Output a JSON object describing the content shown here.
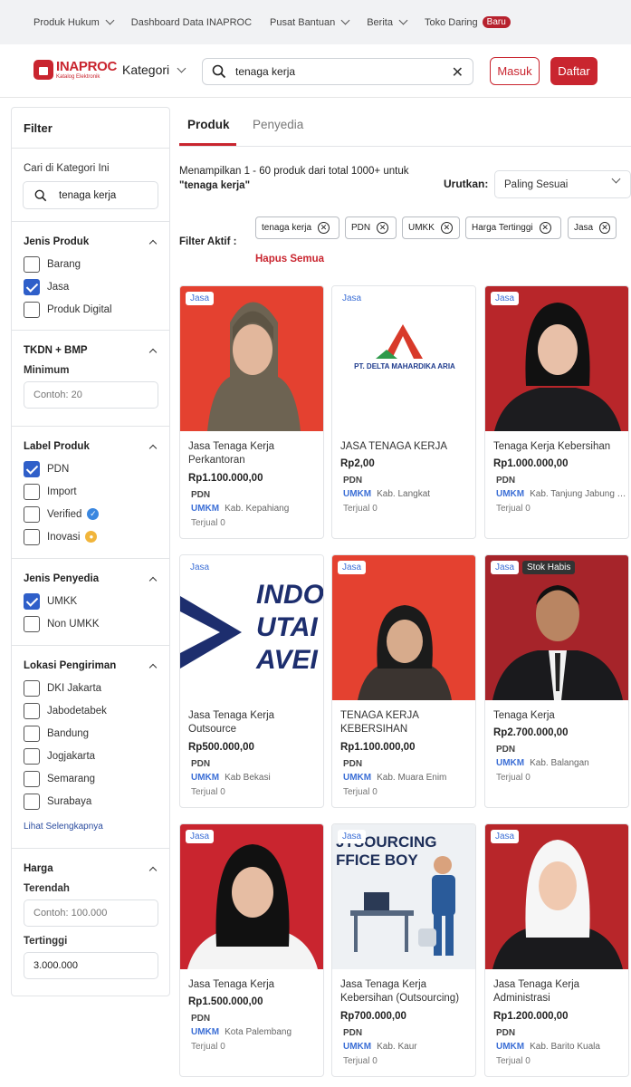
{
  "topbar": {
    "items": [
      {
        "label": "Produk Hukum",
        "chevron": true
      },
      {
        "label": "Dashboard Data INAPROC",
        "chevron": false
      },
      {
        "label": "Pusat Bantuan",
        "chevron": true
      },
      {
        "label": "Berita",
        "chevron": true
      },
      {
        "label": "Toko Daring",
        "chevron": false
      }
    ],
    "badge": "Baru"
  },
  "header": {
    "logo_main": "INAPROC",
    "logo_sub": "Katalog Elektronik",
    "kategori": "Kategori",
    "search_value": "tenaga kerja",
    "masuk": "Masuk",
    "daftar": "Daftar"
  },
  "sidebar": {
    "title": "Filter",
    "search_label": "Cari di Kategori Ini",
    "search_value": "tenaga kerja",
    "jenis_produk": {
      "title": "Jenis Produk",
      "options": [
        {
          "label": "Barang",
          "checked": false
        },
        {
          "label": "Jasa",
          "checked": true
        },
        {
          "label": "Produk Digital",
          "checked": false
        }
      ]
    },
    "tkdn": {
      "title": "TKDN + BMP",
      "min_label": "Minimum",
      "placeholder": "Contoh: 20"
    },
    "label_produk": {
      "title": "Label Produk",
      "options": [
        {
          "label": "PDN",
          "checked": true
        },
        {
          "label": "Import",
          "checked": false
        },
        {
          "label": "Verified",
          "checked": false,
          "icon": "verified-icon"
        },
        {
          "label": "Inovasi",
          "checked": false,
          "icon": "lightbulb-icon"
        }
      ]
    },
    "jenis_penyedia": {
      "title": "Jenis Penyedia",
      "options": [
        {
          "label": "UMKK",
          "checked": true
        },
        {
          "label": "Non UMKK",
          "checked": false
        }
      ]
    },
    "lokasi": {
      "title": "Lokasi Pengiriman",
      "options": [
        {
          "label": "DKI Jakarta",
          "checked": false
        },
        {
          "label": "Jabodetabek",
          "checked": false
        },
        {
          "label": "Bandung",
          "checked": false
        },
        {
          "label": "Jogjakarta",
          "checked": false
        },
        {
          "label": "Semarang",
          "checked": false
        },
        {
          "label": "Surabaya",
          "checked": false
        }
      ],
      "more": "Lihat Selengkapnya"
    },
    "harga": {
      "title": "Harga",
      "low_label": "Terendah",
      "low_placeholder": "Contoh: 100.000",
      "high_label": "Tertinggi",
      "high_value": "3.000.000"
    }
  },
  "tabs": [
    "Produk",
    "Penyedia"
  ],
  "results": {
    "line1": "Menampilkan 1 - 60 produk dari total 1000+ untuk",
    "query": "\"tenaga kerja\""
  },
  "sort": {
    "label": "Urutkan:",
    "value": "Paling Sesuai"
  },
  "filters": {
    "label": "Filter Aktif :",
    "chips": [
      "tenaga kerja",
      "PDN",
      "UMKK",
      "Harga Tertinggi",
      "Jasa"
    ],
    "clear": "Hapus Semua"
  },
  "products": [
    {
      "tag": "Jasa",
      "name": "Jasa Tenaga Kerja Perkantoran",
      "price": "Rp1.100.000,00",
      "pdn": "PDN",
      "umkm": "UMKM",
      "loc": "Kab. Kepahiang",
      "sold": "Terjual 0"
    },
    {
      "tag": "Jasa",
      "name": "JASA TENAGA KERJA",
      "price": "Rp2,00",
      "pdn": "PDN",
      "umkm": "UMKM",
      "loc": "Kab. Langkat",
      "sold": "Terjual 0",
      "logo_text": "PT. DELTA MAHARDIKA ARIA"
    },
    {
      "tag": "Jasa",
      "name": "Tenaga Kerja Kebersihan",
      "price": "Rp1.000.000,00",
      "pdn": "PDN",
      "umkm": "UMKM",
      "loc": "Kab. Tanjung Jabung Timur",
      "sold": "Terjual 0"
    },
    {
      "tag": "Jasa",
      "name": "Jasa Tenaga Kerja Outsource",
      "price": "Rp500.000,00",
      "pdn": "PDN",
      "umkm": "UMKM",
      "loc": "Kab Bekasi",
      "sold": "Terjual 0",
      "logo_text": [
        "INDO",
        "UTAI",
        "AVEI"
      ]
    },
    {
      "tag": "Jasa",
      "name": "TENAGA KERJA KEBERSIHAN",
      "price": "Rp1.100.000,00",
      "pdn": "PDN",
      "umkm": "UMKM",
      "loc": "Kab. Muara Enim",
      "sold": "Terjual 0"
    },
    {
      "tag": "Jasa",
      "tag2": "Stok Habis",
      "name": "Tenaga Kerja",
      "price": "Rp2.700.000,00",
      "pdn": "PDN",
      "umkm": "UMKM",
      "loc": "Kab. Balangan",
      "sold": "Terjual 0"
    },
    {
      "tag": "Jasa",
      "name": "Jasa Tenaga Kerja",
      "price": "Rp1.500.000,00",
      "pdn": "PDN",
      "umkm": "UMKM",
      "loc": "Kota Palembang",
      "sold": "Terjual 0"
    },
    {
      "tag": "Jasa",
      "name": "Jasa Tenaga Kerja Kebersihan (Outsourcing)",
      "price": "Rp700.000,00",
      "pdn": "PDN",
      "umkm": "UMKM",
      "loc": "Kab. Kaur",
      "sold": "Terjual 0",
      "logo_text": [
        "JTSOURCING",
        "FFICE BOY"
      ]
    },
    {
      "tag": "Jasa",
      "name": "Jasa Tenaga Kerja Administrasi",
      "price": "Rp1.200.000,00",
      "pdn": "PDN",
      "umkm": "UMKM",
      "loc": "Kab. Barito Kuala",
      "sold": "Terjual 0"
    }
  ],
  "colors": {
    "brand": "#c9252f",
    "accent_blue": "#2f5fc9",
    "photo_red": "#e8412f",
    "photo_darkred": "#b8262a"
  }
}
